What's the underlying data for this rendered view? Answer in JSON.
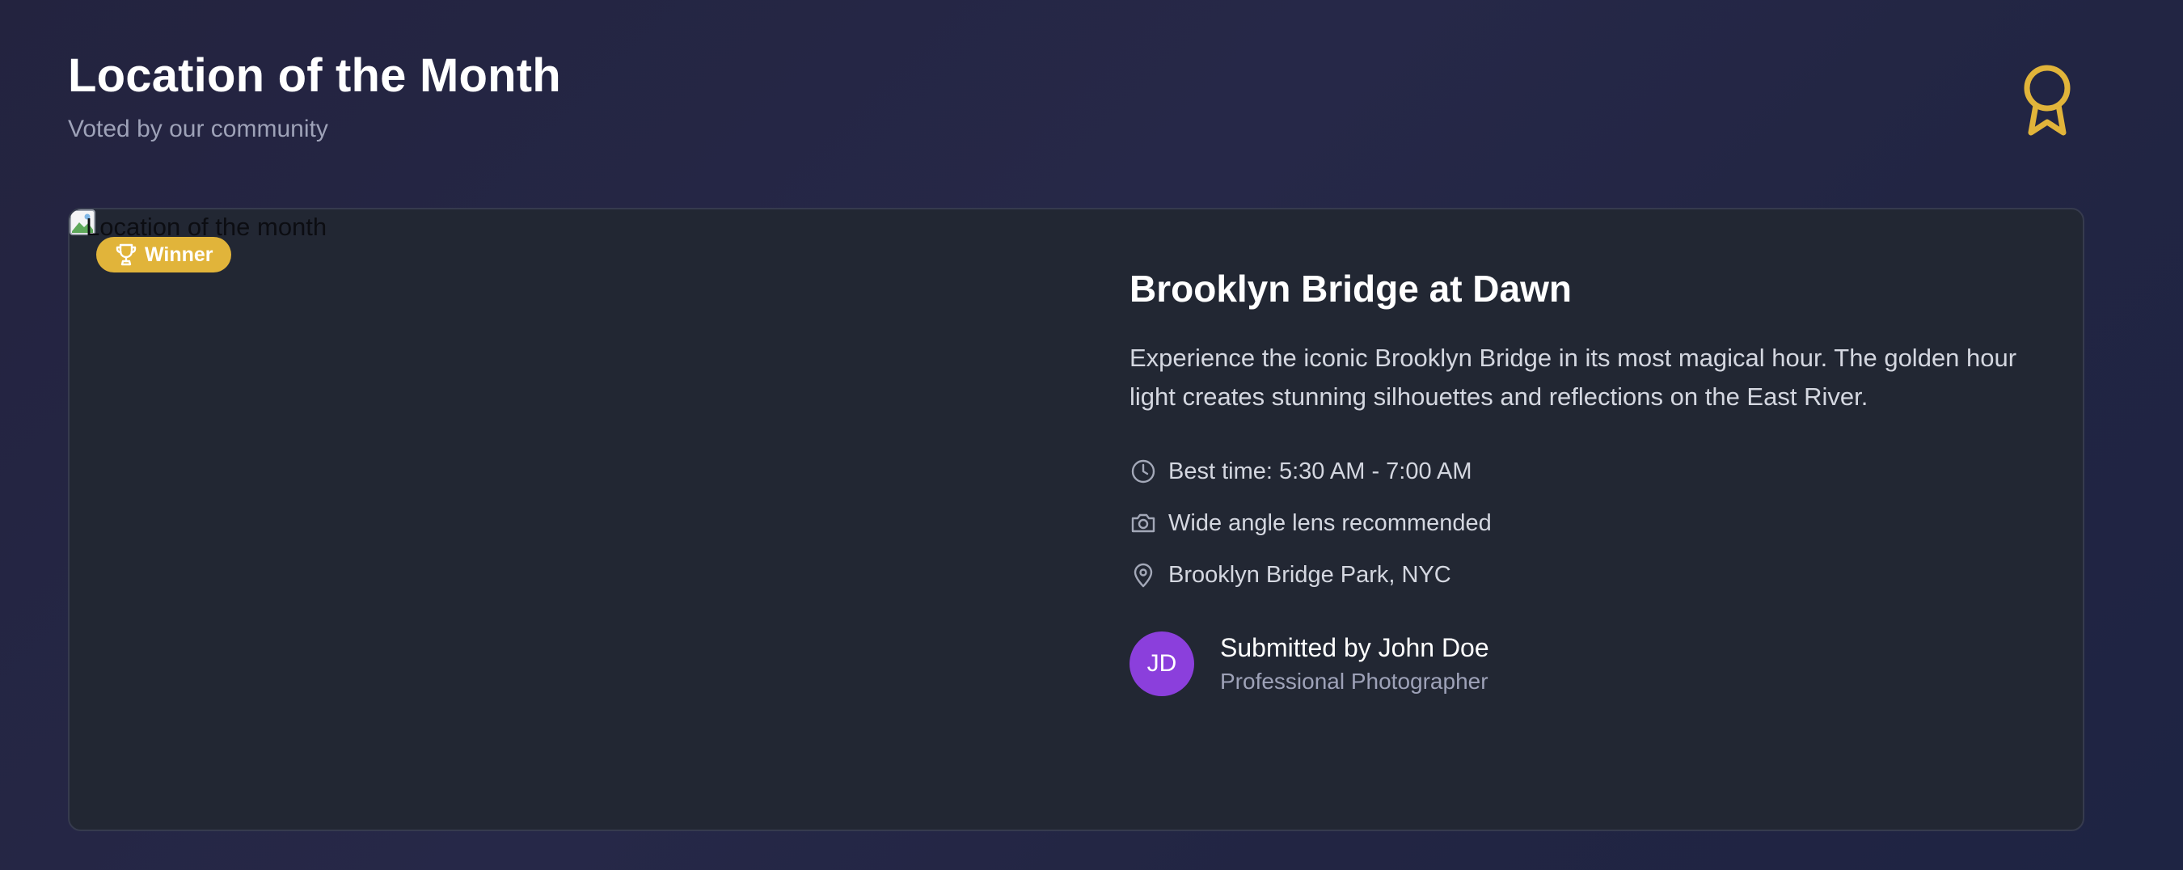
{
  "header": {
    "title": "Location of the Month",
    "subtitle": "Voted by our community",
    "icon": "award-icon"
  },
  "card": {
    "image": {
      "alt": "Location of the month",
      "icon": "broken-image-icon"
    },
    "badge": {
      "label": "Winner",
      "icon": "trophy-icon"
    },
    "title": "Brooklyn Bridge at Dawn",
    "description": "Experience the iconic Brooklyn Bridge in its most magical hour. The golden hour light creates stunning silhouettes and reflections on the East River.",
    "details": [
      {
        "icon": "clock-icon",
        "text": "Best time: 5:30 AM - 7:00 AM"
      },
      {
        "icon": "camera-icon",
        "text": "Wide angle lens recommended"
      },
      {
        "icon": "map-pin-icon",
        "text": "Brooklyn Bridge Park, NYC"
      }
    ],
    "submitter": {
      "initials": "JD",
      "name_line": "Submitted by John Doe",
      "role": "Professional Photographer"
    }
  },
  "colors": {
    "accent_gold": "#e1b43a",
    "avatar_purple": "#8b3fdc",
    "card_background": "#222733",
    "muted_text": "#9ea2b8"
  }
}
